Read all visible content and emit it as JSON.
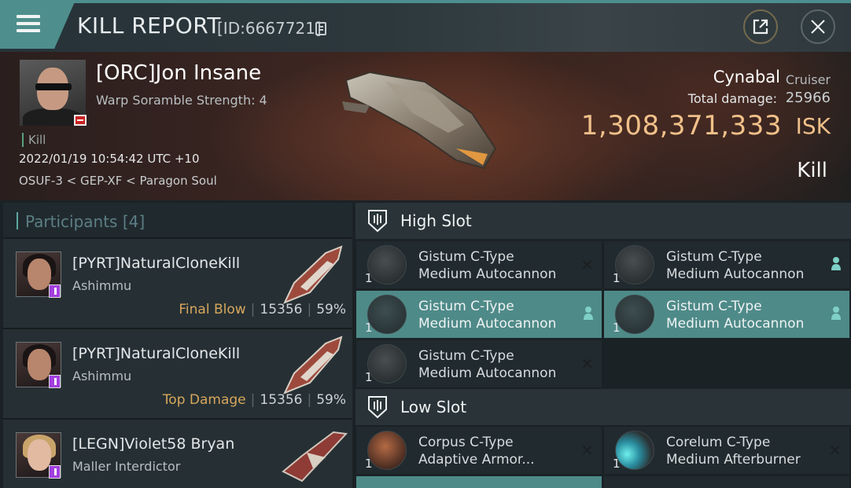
{
  "titlebar": {
    "title": "KILL REPORT",
    "kill_id": "[ID:6667721]",
    "menu_icon": "hamburger-icon",
    "share_icon": "external-link-icon",
    "close_icon": "close-icon"
  },
  "victim": {
    "name": "[ORC]Jon Insane",
    "scram": "Warp Soramble Strength: 4",
    "kill_tag": "Kill",
    "date": "2022/01/19 10:54:42 UTC +10",
    "location": "OSUF-3 < GEP-XF < Paragon Soul"
  },
  "ship": {
    "name": "Cynabal",
    "class": "Cruiser",
    "damage_label": "Total damage:",
    "damage_value": "25966",
    "isk_value": "1,308,371,333",
    "isk_unit": "ISK",
    "result": "Kill"
  },
  "participants": {
    "title": "Participants [4]",
    "items": [
      {
        "name": "[PYRT]NaturalCloneKill",
        "ship": "Ashimmu",
        "role": "Final Blow",
        "damage": "15356",
        "percent": "59%"
      },
      {
        "name": "[PYRT]NaturalCloneKill",
        "ship": "Ashimmu",
        "role": "Top Damage",
        "damage": "15356",
        "percent": "59%"
      },
      {
        "name": "[LEGN]Violet58 Bryan",
        "ship": "Maller Interdictor",
        "role": "",
        "damage": "",
        "percent": ""
      }
    ]
  },
  "fitting": {
    "high_slot": {
      "title": "High Slot",
      "modules": [
        {
          "qty": "1",
          "line1": "Gistum C-Type",
          "line2": "Medium Autocannon",
          "status": "destroyed"
        },
        {
          "qty": "1",
          "line1": "Gistum C-Type",
          "line2": "Medium Autocannon",
          "status": "dropped"
        },
        {
          "qty": "1",
          "line1": "Gistum C-Type",
          "line2": "Medium Autocannon",
          "status": "dropped"
        },
        {
          "qty": "1",
          "line1": "Gistum C-Type",
          "line2": "Medium Autocannon",
          "status": "dropped"
        },
        {
          "qty": "1",
          "line1": "Gistum C-Type",
          "line2": "Medium Autocannon",
          "status": "destroyed"
        }
      ]
    },
    "low_slot": {
      "title": "Low Slot",
      "modules": [
        {
          "qty": "1",
          "line1": "Corpus C-Type",
          "line2": "Adaptive Armor...",
          "status": "destroyed"
        },
        {
          "qty": "1",
          "line1": "Corelum C-Type",
          "line2": "Medium Afterburner",
          "status": "destroyed"
        }
      ]
    }
  },
  "colors": {
    "accent": "#4e8f8d",
    "isk": "#f0c089",
    "role": "#d7a75c",
    "highlight": "#4e8a88"
  }
}
